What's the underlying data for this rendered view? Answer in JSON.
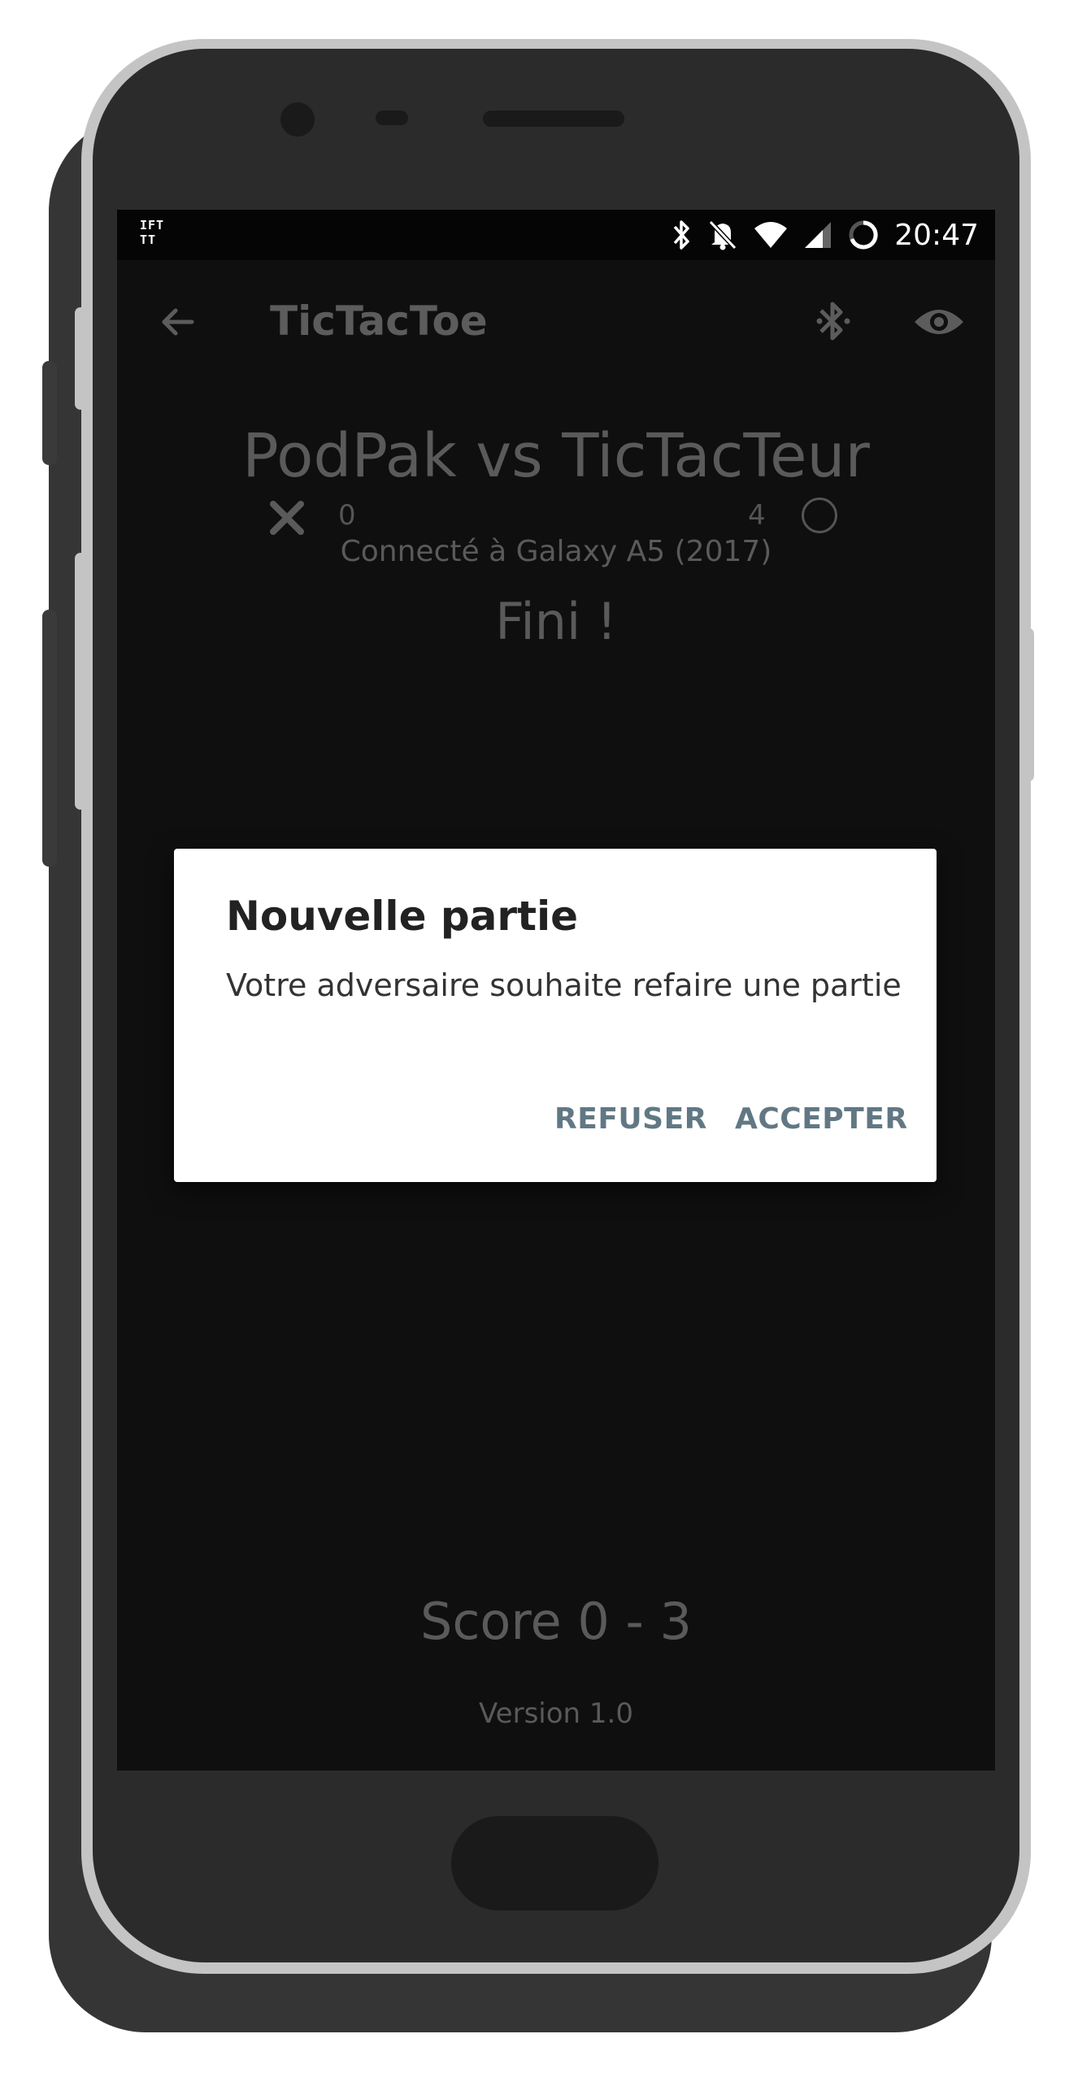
{
  "status_bar": {
    "left_icon": "IFTTT",
    "icons": [
      "bluetooth-icon",
      "bell-off-icon",
      "wifi-icon",
      "signal-icon",
      "battery-icon"
    ],
    "time": "20:47"
  },
  "app_bar": {
    "title": "TicTacToe",
    "back_icon": "arrow-back-icon",
    "actions": [
      "bluetooth-searching-icon",
      "eye-icon"
    ]
  },
  "game": {
    "players": "PodPak vs TicTacTeur",
    "score_x": "0",
    "score_o": "4",
    "connected": "Connecté à Galaxy A5 (2017)",
    "state": "Fini !",
    "total_score": "Score 0 - 3",
    "version": "Version 1.0"
  },
  "dialog": {
    "title": "Nouvelle partie",
    "message": "Votre adversaire souhaite refaire une partie",
    "refuse_label": "REFUSER",
    "accept_label": "ACCEPTER"
  },
  "colors": {
    "screen_bg": "#0f0f0f",
    "dialog_button": "#617884",
    "dimmed_text": "#5a5a5a"
  }
}
